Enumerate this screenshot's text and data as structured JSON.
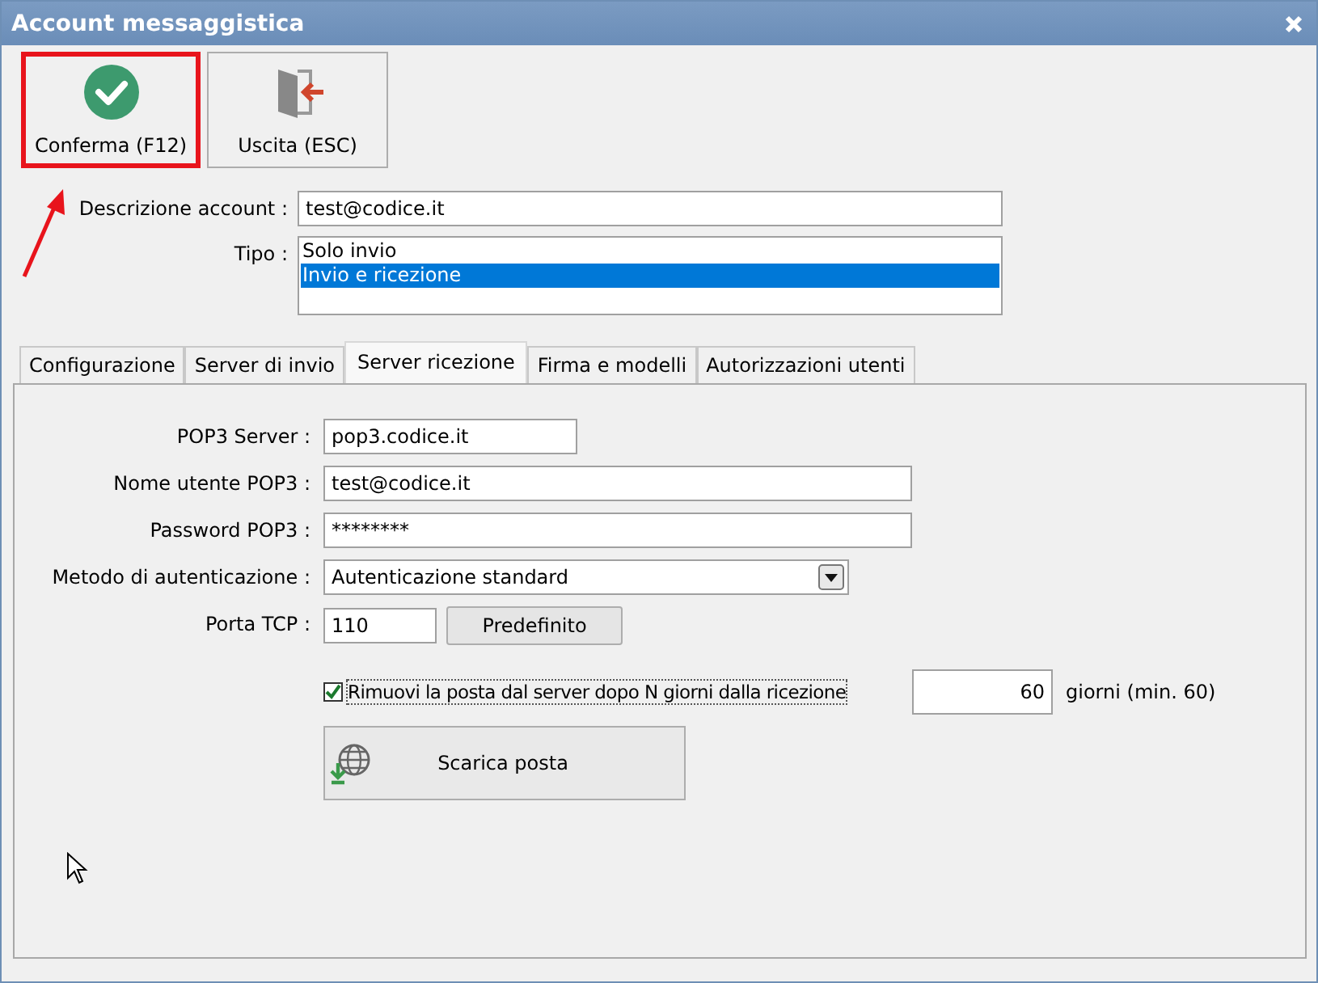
{
  "window": {
    "title": "Account messaggistica"
  },
  "toolbar": [
    {
      "label": "Conferma (F12)",
      "kind": "confirm",
      "highlighted": true
    },
    {
      "label": "Uscita (ESC)",
      "kind": "exit",
      "highlighted": false
    }
  ],
  "account": {
    "label": "Descrizione account :",
    "value": "test@codice.it"
  },
  "tipo": {
    "label": "Tipo :",
    "options": [
      {
        "label": "Solo invio",
        "selected": false
      },
      {
        "label": "Invio e ricezione",
        "selected": true
      }
    ]
  },
  "tabs": [
    {
      "label": "Configurazione",
      "selected": false
    },
    {
      "label": "Server di invio",
      "selected": false
    },
    {
      "label": "Server ricezione",
      "selected": true
    },
    {
      "label": "Firma e modelli",
      "selected": false
    },
    {
      "label": "Autorizzazioni utenti",
      "selected": false
    }
  ],
  "pop3_server": {
    "label": "POP3 Server :",
    "value": "pop3.codice.it"
  },
  "username": {
    "label": "Nome utente POP3 :",
    "value": "test@codice.it"
  },
  "password": {
    "label": "Password POP3 :",
    "value": "********"
  },
  "auth_method": {
    "label": "Metodo di autenticazione :",
    "value": "Autenticazione standard"
  },
  "tcp_port": {
    "label": "Porta TCP :",
    "value": "110",
    "button": "Predefinito"
  },
  "remove_mail": {
    "checked": true,
    "label": "Rimuovi la posta dal server dopo N giorni dalla ricezione",
    "days": "60",
    "days_note": "giorni (min. 60)"
  },
  "download_button": {
    "label": "Scarica posta"
  }
}
